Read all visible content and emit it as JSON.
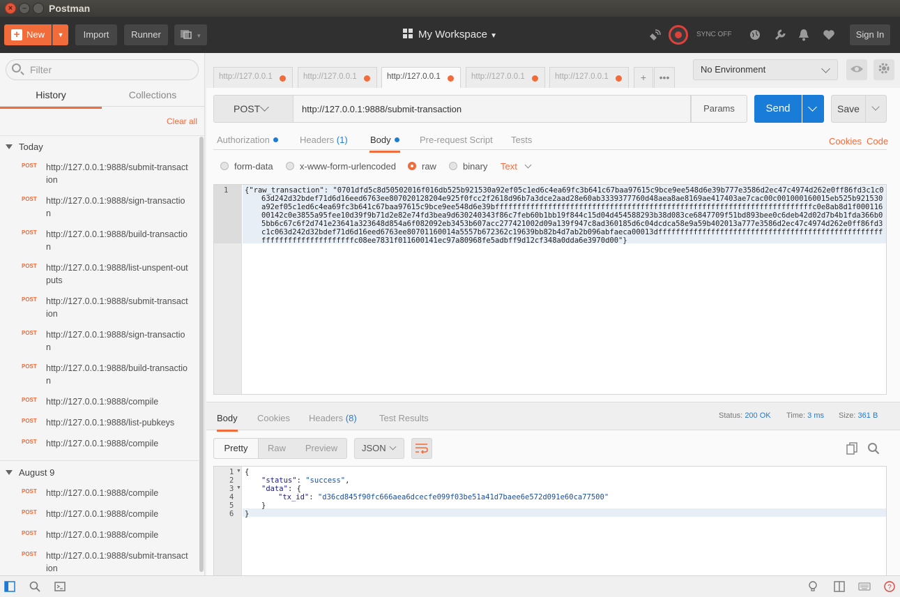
{
  "window": {
    "title": "Postman"
  },
  "header": {
    "new_label": "New",
    "import_label": "Import",
    "runner_label": "Runner",
    "workspace_label": "My Workspace",
    "sync_label": "SYNC OFF",
    "signin_label": "Sign In"
  },
  "sidebar": {
    "filter_placeholder": "Filter",
    "tabs": [
      "History",
      "Collections"
    ],
    "clear_all": "Clear all",
    "groups": [
      {
        "title": "Today",
        "items": [
          {
            "method": "POST",
            "url": "http://127.0.0.1:9888/submit-transaction"
          },
          {
            "method": "POST",
            "url": "http://127.0.0.1:9888/sign-transaction"
          },
          {
            "method": "POST",
            "url": "http://127.0.0.1:9888/build-transaction"
          },
          {
            "method": "POST",
            "url": "http://127.0.0.1:9888/list-unspent-outputs"
          },
          {
            "method": "POST",
            "url": "http://127.0.0.1:9888/submit-transaction"
          },
          {
            "method": "POST",
            "url": "http://127.0.0.1:9888/sign-transaction"
          },
          {
            "method": "POST",
            "url": "http://127.0.0.1:9888/build-transaction"
          },
          {
            "method": "POST",
            "url": "http://127.0.0.1:9888/compile"
          },
          {
            "method": "POST",
            "url": "http://127.0.0.1:9888/list-pubkeys"
          },
          {
            "method": "POST",
            "url": "http://127.0.0.1:9888/compile"
          }
        ]
      },
      {
        "title": "August 9",
        "items": [
          {
            "method": "POST",
            "url": "http://127.0.0.1:9888/compile"
          },
          {
            "method": "POST",
            "url": "http://127.0.0.1:9888/compile"
          },
          {
            "method": "POST",
            "url": "http://127.0.0.1:9888/compile"
          },
          {
            "method": "POST",
            "url": "http://127.0.0.1:9888/submit-transaction"
          }
        ]
      }
    ]
  },
  "request_tabs": [
    {
      "label": "http://127.0.0.1",
      "active": false
    },
    {
      "label": "http://127.0.0.1",
      "active": false
    },
    {
      "label": "http://127.0.0.1",
      "active": true
    },
    {
      "label": "http://127.0.0.1",
      "active": false
    },
    {
      "label": "http://127.0.0.1",
      "active": false
    }
  ],
  "environment": {
    "selected": "No Environment"
  },
  "request": {
    "method": "POST",
    "url": "http://127.0.0.1:9888/submit-transaction",
    "params_label": "Params",
    "send_label": "Send",
    "save_label": "Save",
    "subtabs": {
      "authorization": "Authorization",
      "headers": "Headers",
      "headers_count": "(1)",
      "body": "Body",
      "prerequest": "Pre-request Script",
      "tests": "Tests"
    },
    "cookies_link": "Cookies",
    "code_link": "Code",
    "body_modes": {
      "form_data": "form-data",
      "urlencoded": "x-www-form-urlencoded",
      "raw": "raw",
      "binary": "binary",
      "selected": "raw"
    },
    "content_type": "Text",
    "body_line_number": "1",
    "body_text": "{\"raw_transaction\": \"0701dfd5c8d50502016f016db525b921530a92ef05c1ed6c4ea69fc3b641c67baa97615c9bce9ee548d6e39b777e3586d2ec47c4974d262e0ff86fd3c1c063d242d32bdef71d6d16eed6763ee807020128204e925f0fcc2f2618d96b7a3dce2aad28e60ab3339377760d48aea8ae8169ae417403ae7cac00c001000160015eb525b921530a92ef05c1ed6c4ea69fc3b641c67baa97615c9bce9ee548d6e39bffffffffffffffffffffffffffffffffffffffffffffffffffffffffffffffffffffffffc0e8ab8d1f00011600142c0e3855a95fee10d39f9b71d2e82e74fd3bea9d630240343f86c7feb60b1bb19f844c15d04d454588293b38d083ce6847709f51bd893bee0c6deb42d02d7b4b1fda366b05bb6c67c6f2d741e23641a323648d854a6f082092eb3453b607acc277421002d09a139f947c8ad360185d6c04dcdca58e9a59b402013a777e3586d2ec47c4974d262e0ff86fd3c1c063d242d32bdef71d6d16eed6763ee80701160014a5557b672362c19639bb82b4d7ab2b096abfaeca00013dffffffffffffffffffffffffffffffffffffffffffffffffffffffffffffffffffffffffc08ee7831f011600141ec97a80968fe5adbff9d12cf348a0dda6e3970d00\"}"
  },
  "response": {
    "tabs": {
      "body": "Body",
      "cookies": "Cookies",
      "headers": "Headers",
      "headers_count": "(8)",
      "test_results": "Test Results"
    },
    "status_label": "Status:",
    "status_value": "200 OK",
    "time_label": "Time:",
    "time_value": "3 ms",
    "size_label": "Size:",
    "size_value": "361 B",
    "formats": [
      "Pretty",
      "Raw",
      "Preview"
    ],
    "format_type": "JSON",
    "line_numbers": [
      "1",
      "2",
      "3",
      "4",
      "5",
      "6"
    ],
    "json": {
      "open": "{",
      "status_key": "\"status\"",
      "status_value": "\"success\"",
      "data_key": "\"data\"",
      "tx_id_key": "\"tx_id\"",
      "tx_id_value": "\"d36cd845f90fc666aea6dcecfe099f03be51a41d7baee6e572d091e60ca77500\"",
      "inner_close": "}",
      "close": "}"
    }
  },
  "icons": {
    "header": [
      "builder-icon",
      "satellite-icon",
      "sync-icon",
      "globe-icon",
      "wrench-icon",
      "bell-icon",
      "heart-icon"
    ],
    "status_bar": [
      "sidebar-toggle-icon",
      "search-icon",
      "console-icon",
      "lightbulb-icon",
      "two-pane-icon",
      "keyboard-icon",
      "help-icon"
    ]
  }
}
